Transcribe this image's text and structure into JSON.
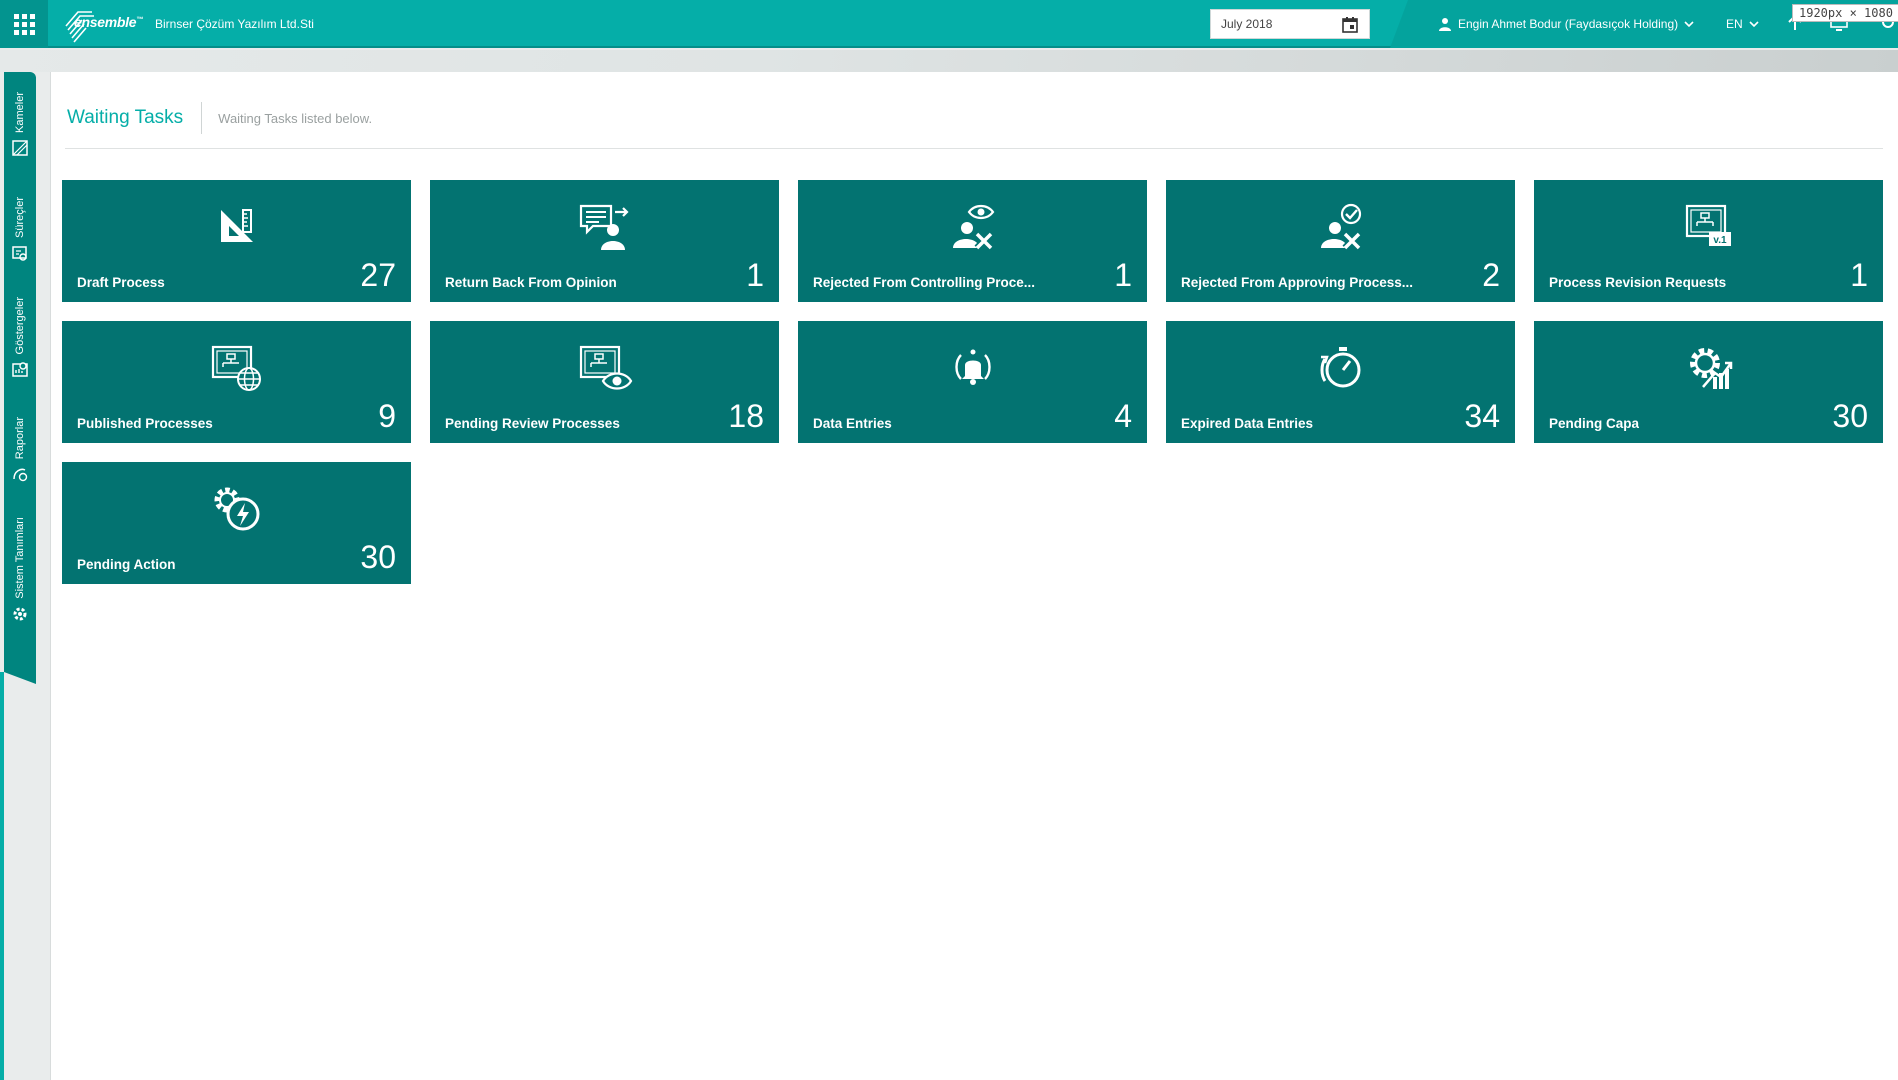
{
  "header": {
    "logo_text": "ensemble",
    "logo_tm": "™",
    "company": "Birnser Çözüm Yazılım Ltd.Sti",
    "date_value": "July 2018",
    "user_name": "Engin Ahmet Bodur (Faydasıçok Holding)",
    "language": "EN",
    "size_tag": "1920px × 1080",
    "accent_color": "#05aea8"
  },
  "sidebar": {
    "items": [
      {
        "label": "Kameler",
        "icon": "camera-icon"
      },
      {
        "label": "Süreçler",
        "icon": "process-icon"
      },
      {
        "label": "Göstergeler",
        "icon": "indicator-icon"
      },
      {
        "label": "Raporlar",
        "icon": "report-icon"
      },
      {
        "label": "Sistem Tanımları",
        "icon": "gear-icon"
      }
    ]
  },
  "page": {
    "title": "Waiting Tasks",
    "subtitle": "Waiting Tasks listed below."
  },
  "tiles": [
    {
      "label": "Draft Process",
      "count": "27",
      "icon": "set-square-icon"
    },
    {
      "label": "Return Back From Opinion",
      "count": "1",
      "icon": "opinion-return-icon"
    },
    {
      "label": "Rejected From Controlling Proce...",
      "count": "1",
      "icon": "user-eye-reject-icon"
    },
    {
      "label": "Rejected From Approving Process...",
      "count": "2",
      "icon": "user-check-reject-icon"
    },
    {
      "label": "Process Revision Requests",
      "count": "1",
      "icon": "process-version-icon"
    },
    {
      "label": "Published Processes",
      "count": "9",
      "icon": "process-globe-icon"
    },
    {
      "label": "Pending Review Processes",
      "count": "18",
      "icon": "process-eye-icon"
    },
    {
      "label": "Data Entries",
      "count": "4",
      "icon": "bell-icon"
    },
    {
      "label": "Expired Data Entries",
      "count": "34",
      "icon": "stopwatch-icon"
    },
    {
      "label": "Pending Capa",
      "count": "30",
      "icon": "gear-chart-icon"
    },
    {
      "label": "Pending Action",
      "count": "30",
      "icon": "gear-bolt-icon"
    }
  ],
  "tile_color": "#037371"
}
